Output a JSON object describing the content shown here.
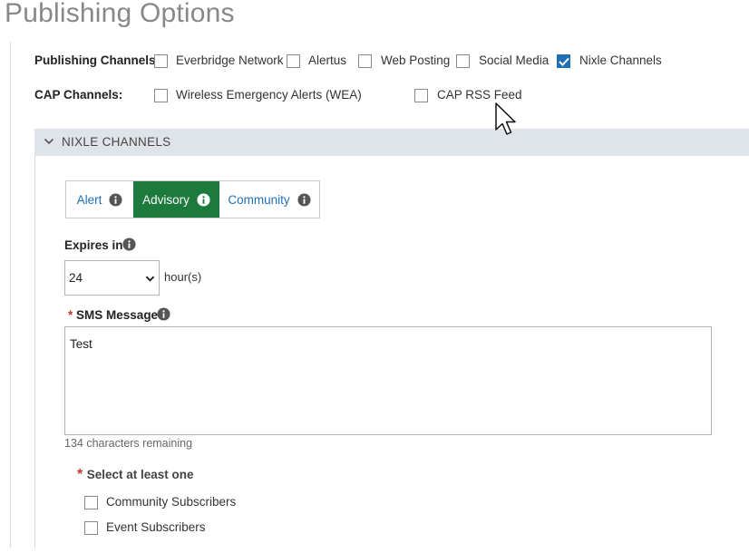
{
  "page": {
    "title": "Publishing Options"
  },
  "publishing_channels": {
    "label": "Publishing Channels:",
    "items": [
      {
        "label": "Everbridge Network",
        "checked": false
      },
      {
        "label": "Alertus",
        "checked": false
      },
      {
        "label": "Web Posting",
        "checked": false
      },
      {
        "label": "Social Media",
        "checked": false
      },
      {
        "label": "Nixle Channels",
        "checked": true
      }
    ]
  },
  "cap_channels": {
    "label": "CAP Channels:",
    "items": [
      {
        "label": "Wireless Emergency Alerts (WEA)",
        "checked": false
      },
      {
        "label": "CAP RSS Feed",
        "checked": false
      }
    ]
  },
  "nixle_section": {
    "title": "NIXLE CHANNELS",
    "tabs": [
      {
        "label": "Alert",
        "active": false
      },
      {
        "label": "Advisory",
        "active": true
      },
      {
        "label": "Community",
        "active": false
      }
    ],
    "expires": {
      "label": "Expires in",
      "value": "24",
      "unit": "hour(s)"
    },
    "sms": {
      "required_mark": "*",
      "label": "SMS Message",
      "value": "Test",
      "remaining": "134 characters remaining"
    },
    "subscribers": {
      "required_mark": "*",
      "label": "Select at least one",
      "items": [
        {
          "label": "Community Subscribers",
          "checked": false
        },
        {
          "label": "Event Subscribers",
          "checked": false
        }
      ]
    }
  },
  "colors": {
    "accent": "#1f6fb7",
    "active_tab": "#1b7a3c",
    "section_bar": "#dfe4ea",
    "required": "#c0392b"
  },
  "icons": {
    "info": "info-circle-icon",
    "check": "check-icon",
    "chevron_down": "chevron-down-icon",
    "cursor": "mouse-pointer-icon"
  }
}
